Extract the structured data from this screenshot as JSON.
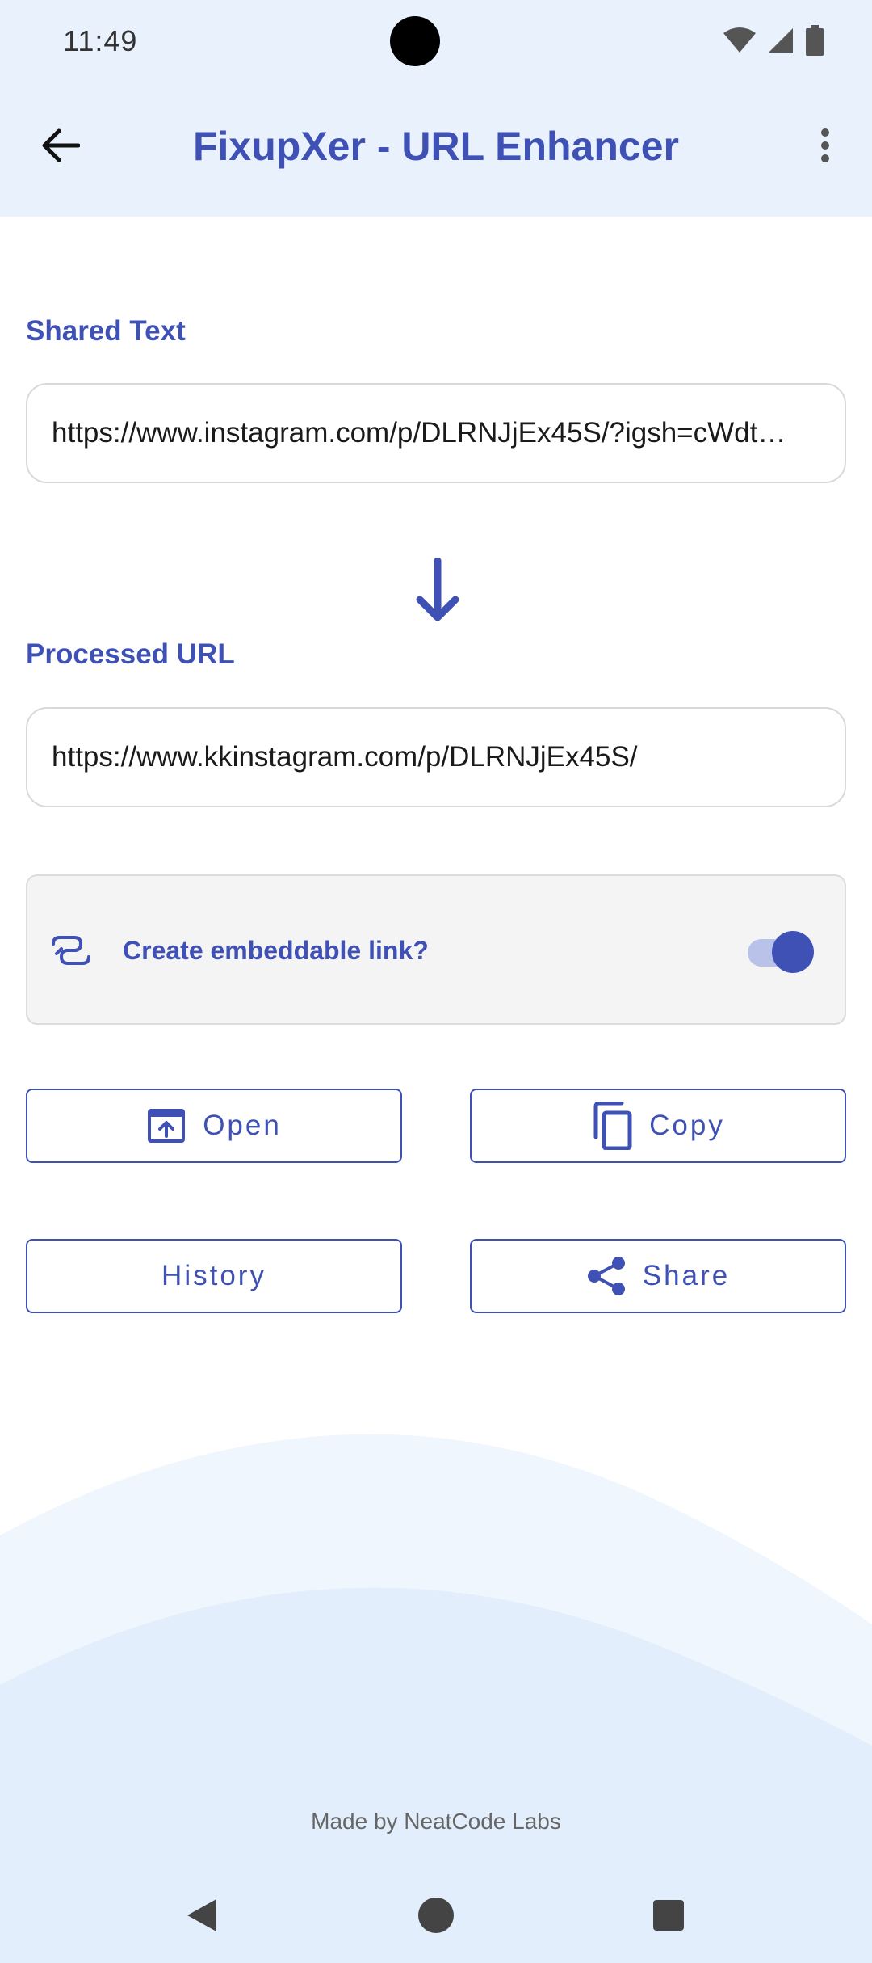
{
  "status_bar": {
    "time": "11:49"
  },
  "app_bar": {
    "title": "FixupXer - URL Enhancer",
    "back_icon": "arrow-left-icon",
    "menu_icon": "more-vert-icon"
  },
  "shared": {
    "label": "Shared Text",
    "value": "https://www.instagram.com/p/DLRNJjEx45S/?igsh=cWdt…"
  },
  "processed": {
    "label": "Processed URL",
    "value": "https://www.kkinstagram.com/p/DLRNJjEx45S/"
  },
  "embed": {
    "label": "Create embeddable link?",
    "enabled": true,
    "icon": "embed-link-icon"
  },
  "buttons": {
    "open": "Open",
    "copy": "Copy",
    "history": "History",
    "share": "Share"
  },
  "footer": {
    "credit": "Made by NeatCode Labs"
  },
  "colors": {
    "accent": "#3f51b5",
    "app_bar_bg": "#e8f1fc",
    "wave_light": "#f0f6fd",
    "wave_dark": "#e2eefb"
  }
}
